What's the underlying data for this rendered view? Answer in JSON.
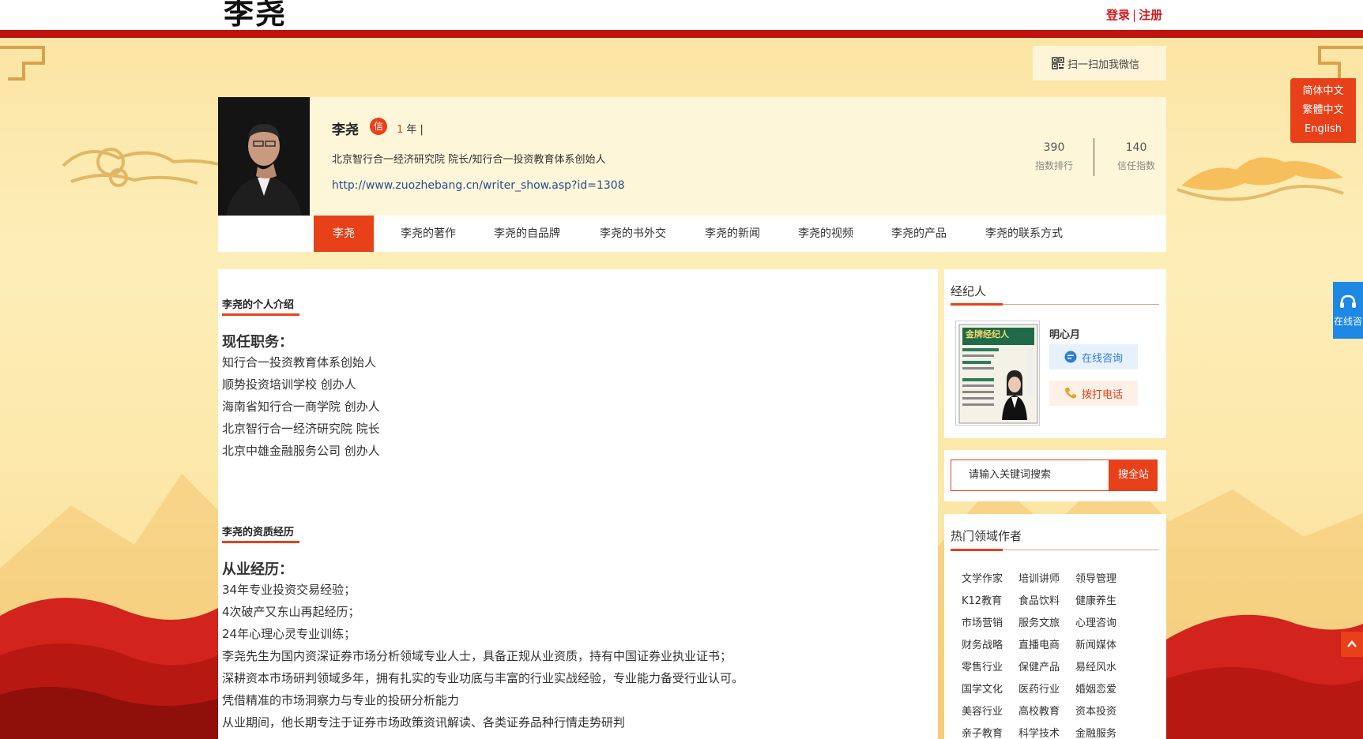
{
  "header": {
    "logo_text": "李尧",
    "login": "登录",
    "separator": "|",
    "register": "注册"
  },
  "wechat": {
    "label": "扫一扫加我微信",
    "icon": "qrcode-icon"
  },
  "lang": {
    "items": [
      "简体中文",
      "繁體中文",
      "English"
    ]
  },
  "side": {
    "consult_label": "在线咨",
    "consult_icon": "headset-icon",
    "up_icon": "chevron-up-icon"
  },
  "profile": {
    "name": "李尧",
    "badge": "信",
    "years_num": "1",
    "years_suffix": "年 |",
    "desc": "北京智行合一经济研究院 院长/知行合一投资教育体系创始人",
    "url": "http://www.zuozhebang.cn/writer_show.asp?id=1308",
    "stats": [
      {
        "value": "390",
        "label": "指数排行"
      },
      {
        "value": "140",
        "label": "信任指数"
      }
    ]
  },
  "nav": {
    "tabs": [
      "李尧",
      "李尧的著作",
      "李尧的自品牌",
      "李尧的书外交",
      "李尧的新闻",
      "李尧的视频",
      "李尧的产品",
      "李尧的联系方式"
    ],
    "active_index": 0
  },
  "main": {
    "intro": {
      "title": "李尧的个人介绍",
      "subtitle": "现任职务：",
      "lines": [
        "知行合一投资教育体系创始人",
        "顺势投资培训学校 创办人",
        "海南省知行合一商学院 创办人",
        "北京智行合一经济研究院 院长",
        "北京中雄金融服务公司 创办人"
      ]
    },
    "qualification": {
      "title": "李尧的资质经历",
      "subtitle": "从业经历：",
      "lines": [
        "34年专业投资交易经验；",
        "4次破产又东山再起经历；",
        "24年心理心灵专业训练；",
        "李尧先生为国内资深证券市场分析领域专业人士，具备正规从业资质，持有中国证券业执业证书；",
        "深耕资本市场研判领域多年，拥有扎实的专业功底与丰富的行业实战经验，专业能力备受行业认可。",
        "凭借精准的市场洞察力与专业的投研分析能力",
        "从业期间，他长期专注于证券市场政策资讯解读、各类证券品种行情走势研判"
      ]
    }
  },
  "sidebar": {
    "agent": {
      "title": "经纪人",
      "name": "明心月",
      "online_btn": "在线咨询",
      "call_btn": "拨打电话",
      "book_title": "金牌经纪人",
      "online_icon": "chat-bubble-icon",
      "call_icon": "phone-icon"
    },
    "search": {
      "placeholder": "请输入关键词搜索",
      "button": "搜全站"
    },
    "hot": {
      "title": "热门领域作者",
      "tags": [
        [
          "文学作家",
          "培训讲师",
          "领导管理"
        ],
        [
          "K12教育",
          "食品饮料",
          "健康养生"
        ],
        [
          "市场营销",
          "服务文旅",
          "心理咨询"
        ],
        [
          "财务战略",
          "直播电商",
          "新闻媒体"
        ],
        [
          "零售行业",
          "保健产品",
          "易经风水"
        ],
        [
          "国学文化",
          "医药行业",
          "婚姻恋爱"
        ],
        [
          "美容行业",
          "高校教育",
          "资本投资"
        ],
        [
          "亲子教育",
          "科学技术",
          "金融服务"
        ]
      ]
    }
  },
  "colors": {
    "accent": "#e8411a",
    "header_red": "#c0130f",
    "link": "#2a4c8f"
  }
}
